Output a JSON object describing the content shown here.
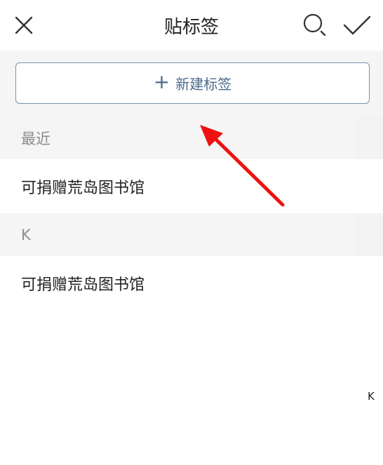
{
  "header": {
    "title": "贴标签",
    "close_icon": "close-icon",
    "search_icon": "search-icon",
    "confirm_icon": "checkmark-icon"
  },
  "new_tag_button": {
    "icon": "plus-icon",
    "label": "新建标签"
  },
  "sections": [
    {
      "title": "最近",
      "items": [
        "可捐赠荒岛图书馆"
      ]
    },
    {
      "title": "K",
      "items": [
        "可捐赠荒岛图书馆"
      ]
    }
  ],
  "index_bar": {
    "letters": [
      "K"
    ]
  },
  "annotation": {
    "type": "arrow",
    "color": "#ee1111"
  },
  "colors": {
    "accent": "#4c6a8c",
    "section_bg": "#f5f5f5",
    "arrow": "#ee1111"
  }
}
